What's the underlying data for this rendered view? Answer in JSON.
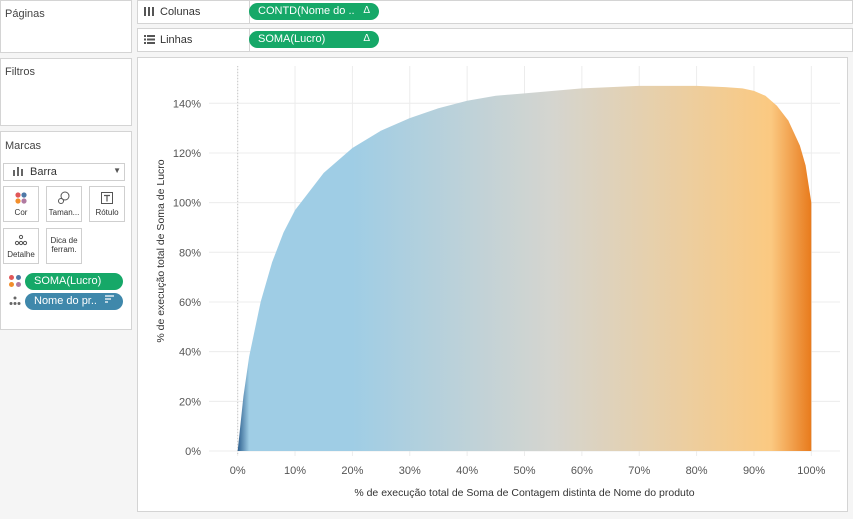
{
  "panels": {
    "pages_title": "Páginas",
    "filters_title": "Filtros",
    "marks_title": "Marcas"
  },
  "shelves": {
    "columns": {
      "label": "Colunas",
      "pill": "CONTD(Nome do ..",
      "delta": "Δ"
    },
    "rows": {
      "label": "Linhas",
      "pill": "SOMA(Lucro)",
      "delta": "Δ"
    }
  },
  "marks": {
    "type": "Barra",
    "buttons": {
      "color": "Cor",
      "size": "Taman...",
      "label": "Rótulo",
      "detail": "Detalhe",
      "tooltip": "Dica de ferram."
    },
    "fields": [
      {
        "label": "SOMA(Lucro)",
        "kind": "color"
      },
      {
        "label": "Nome do pr..",
        "kind": "detail"
      }
    ]
  },
  "icon_names": [
    "columns-icon",
    "rows-icon",
    "bar-chart-icon",
    "color-icon",
    "size-icon",
    "label-icon",
    "detail-icon",
    "tooltip-icon",
    "sort-icon"
  ],
  "colors": {
    "pill_green": "#16a868",
    "pill_blue": "#3f88ab",
    "gradient_start": "#2d5f8e",
    "gradient_light_blue": "#9fcde5",
    "gradient_middle": "#d5d5cf",
    "gradient_light_orange": "#fbc981",
    "gradient_end": "#e87a1c"
  },
  "chart_data": {
    "type": "area",
    "xlabel": "% de execução total de Soma de Contagem distinta de Nome do produto",
    "ylabel": "% de execução total de Soma de Lucro",
    "xlim": [
      -0.05,
      1.05
    ],
    "ylim": [
      -0.02,
      1.55
    ],
    "xticks": [
      "0%",
      "10%",
      "20%",
      "30%",
      "40%",
      "50%",
      "60%",
      "70%",
      "80%",
      "90%",
      "100%"
    ],
    "yticks": [
      "0%",
      "20%",
      "40%",
      "60%",
      "80%",
      "100%",
      "120%",
      "140%"
    ],
    "x": [
      0,
      0.01,
      0.02,
      0.04,
      0.06,
      0.08,
      0.1,
      0.15,
      0.2,
      0.25,
      0.3,
      0.35,
      0.4,
      0.45,
      0.5,
      0.55,
      0.6,
      0.65,
      0.7,
      0.75,
      0.8,
      0.85,
      0.88,
      0.9,
      0.92,
      0.94,
      0.96,
      0.98,
      0.99,
      1.0
    ],
    "y": [
      0.0,
      0.22,
      0.38,
      0.6,
      0.76,
      0.88,
      0.97,
      1.12,
      1.22,
      1.29,
      1.34,
      1.38,
      1.41,
      1.43,
      1.44,
      1.45,
      1.46,
      1.465,
      1.47,
      1.47,
      1.47,
      1.465,
      1.46,
      1.45,
      1.43,
      1.39,
      1.33,
      1.23,
      1.15,
      1.0
    ],
    "grid": true,
    "legend": "none"
  }
}
